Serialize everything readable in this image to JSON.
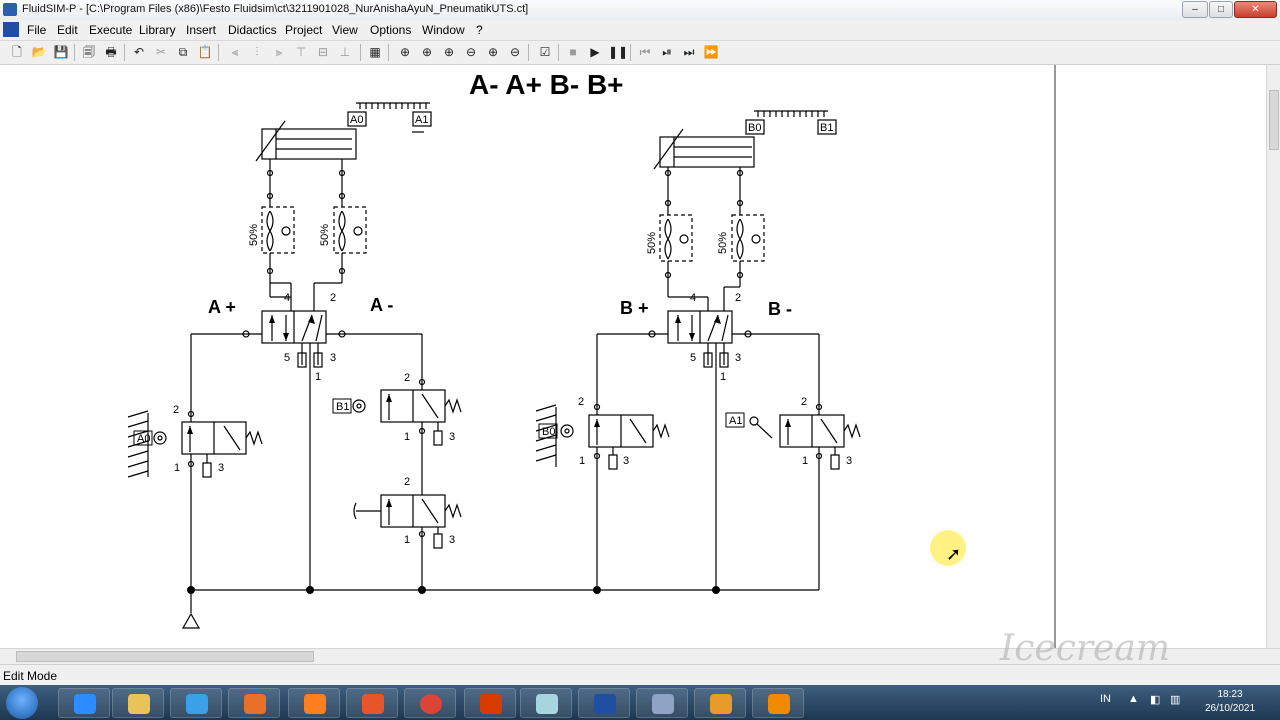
{
  "window": {
    "title": "FluidSIM-P - [C:\\Program Files (x86)\\Festo Fluidsim\\ct\\3211901028_NurAnishaAyuN_PneumatikUTS.ct]",
    "minimize": "–",
    "maximize": "□",
    "close": "✕"
  },
  "menu": [
    "File",
    "Edit",
    "Execute",
    "Library",
    "Insert",
    "Didactics",
    "Project",
    "View",
    "Options",
    "Window",
    "?"
  ],
  "diagram": {
    "heading": "A- A+ B- B+",
    "labels": {
      "a_plus": "A +",
      "a_minus": "A -",
      "b_plus": "B +",
      "b_minus": "B -",
      "a0": "A0",
      "a1": "A1",
      "b0": "B0",
      "b1": "B1",
      "pct": "50%",
      "p4": "4",
      "p2": "2",
      "p5": "5",
      "p3": "3",
      "p1": "1"
    }
  },
  "status": {
    "mode": "Edit Mode"
  },
  "taskbar": {
    "lang": "IN",
    "time": "18:23",
    "date": "26/10/2021"
  },
  "watermark": "Icecream"
}
